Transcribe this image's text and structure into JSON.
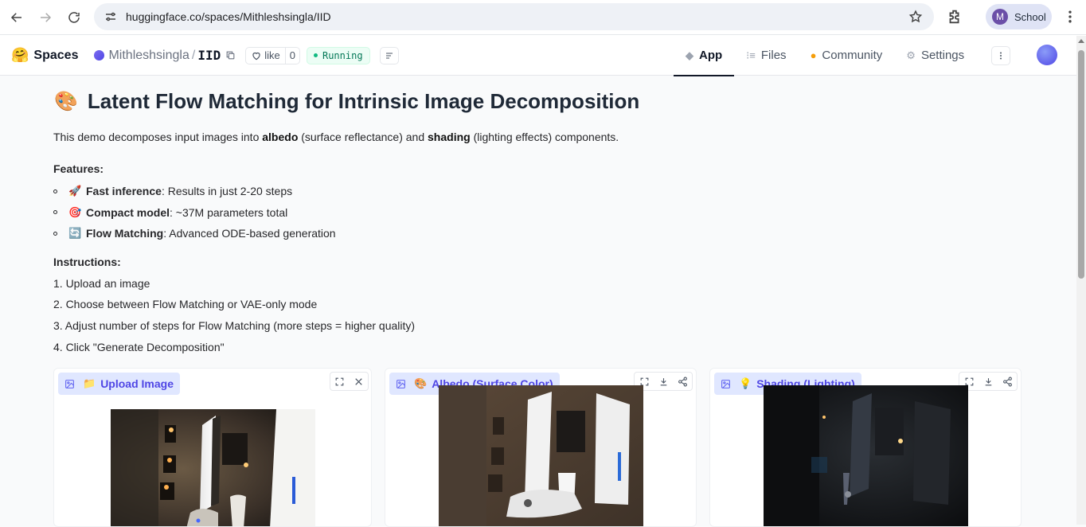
{
  "browser": {
    "url": "huggingface.co/spaces/Mithleshsingla/IID",
    "profile_initial": "M",
    "profile_label": "School"
  },
  "header": {
    "logo": "🤗",
    "spaces_label": "Spaces",
    "owner": "Mithleshsingla",
    "separator": "/",
    "repo": "IID",
    "like_label": "like",
    "like_count": "0",
    "status": "Running",
    "tabs": [
      {
        "label": "App",
        "icon": "cube-icon",
        "active": true
      },
      {
        "label": "Files",
        "icon": "files-icon",
        "active": false
      },
      {
        "label": "Community",
        "icon": "community-icon",
        "active": false
      },
      {
        "label": "Settings",
        "icon": "gear-icon",
        "active": false
      }
    ]
  },
  "main": {
    "title_emoji": "🎨",
    "title": "Latent Flow Matching for Intrinsic Image Decomposition",
    "intro": {
      "pre": "This demo decomposes input images into ",
      "b1": "albedo",
      "mid1": " (surface reflectance) and ",
      "b2": "shading",
      "post": " (lighting effects) components."
    },
    "features_heading": "Features:",
    "features": [
      {
        "emoji": "🚀",
        "bold": "Fast inference",
        "text": ": Results in just 2-20 steps"
      },
      {
        "emoji": "🎯",
        "bold": "Compact model",
        "text": ": ~37M parameters total"
      },
      {
        "emoji": "🔄",
        "bold": "Flow Matching",
        "text": ": Advanced ODE-based generation"
      }
    ],
    "instructions_heading": "Instructions:",
    "instructions": [
      "1. Upload an image",
      "2. Choose between Flow Matching or VAE-only mode",
      "3. Adjust number of steps for Flow Matching (more steps = higher quality)",
      "4. Click \"Generate Decomposition\""
    ]
  },
  "panels": {
    "upload": {
      "emoji": "📁",
      "label": "Upload Image"
    },
    "albedo": {
      "emoji": "🎨",
      "label": "Albedo (Surface Color)"
    },
    "shading": {
      "emoji": "💡",
      "label": "Shading (Lighting)"
    }
  },
  "colors": {
    "accent": "#4f46e5",
    "label_bg": "#e0e7ff",
    "running": "#047857"
  }
}
